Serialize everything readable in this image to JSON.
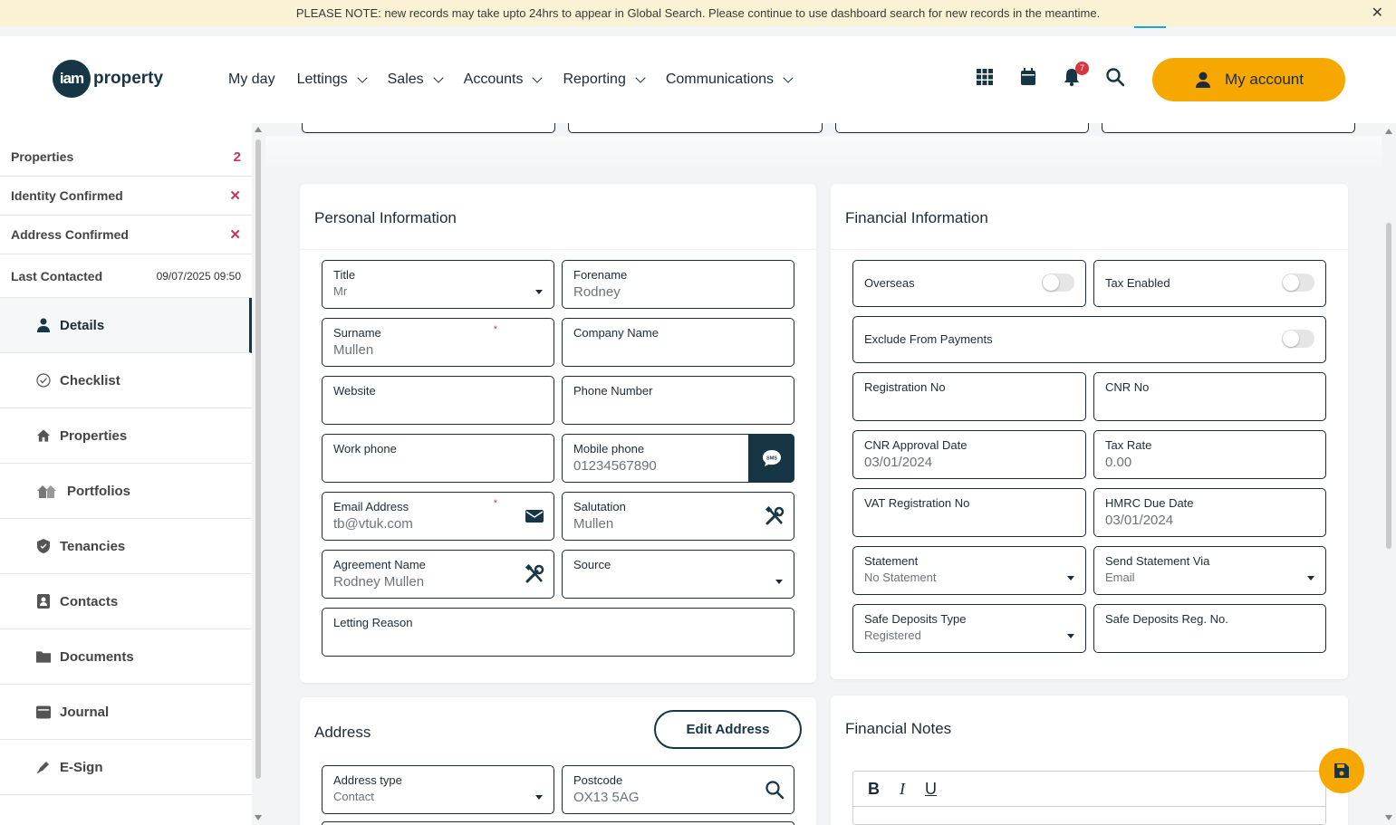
{
  "banner": {
    "text": "PLEASE NOTE: new records may take upto 24hrs to appear in Global Search. Please continue to use dashboard search for new records in the meantime.",
    "close": "✕"
  },
  "logo": {
    "disc": "iam",
    "text": "property"
  },
  "nav": [
    "My day",
    "Lettings",
    "Sales",
    "Accounts",
    "Reporting",
    "Communications"
  ],
  "header": {
    "notifications": "7",
    "account_label": "My account",
    "icons": [
      "grid-icon",
      "calendar-icon",
      "bell-icon",
      "search-icon"
    ]
  },
  "sidebar": {
    "stats": [
      {
        "label": "Properties",
        "value": "2"
      },
      {
        "label": "Identity Confirmed",
        "value": "✕"
      },
      {
        "label": "Address Confirmed",
        "value": "✕"
      },
      {
        "label": "Last Contacted",
        "value": "09/07/2025 09:50"
      }
    ],
    "items": [
      "Details",
      "Checklist",
      "Properties",
      "Portfolios",
      "Tenancies",
      "Contacts",
      "Documents",
      "Journal",
      "E-Sign"
    ]
  },
  "personal": {
    "title": "Personal Information",
    "title_field": {
      "label": "Title",
      "value": "Mr"
    },
    "forename": {
      "label": "Forename",
      "value": "Rodney"
    },
    "surname": {
      "label": "Surname",
      "value": "Mullen",
      "req": "*"
    },
    "company": {
      "label": "Company Name",
      "value": ""
    },
    "website": {
      "label": "Website",
      "value": ""
    },
    "phone": {
      "label": "Phone Number",
      "value": ""
    },
    "work": {
      "label": "Work phone",
      "value": ""
    },
    "mobile": {
      "label": "Mobile phone",
      "value": "01234567890",
      "sms": "SMS"
    },
    "email": {
      "label": "Email Address",
      "value": "tb@vtuk.com",
      "req": "*"
    },
    "salutation": {
      "label": "Salutation",
      "value": "Mullen"
    },
    "agreement": {
      "label": "Agreement Name",
      "value": "Rodney Mullen"
    },
    "source": {
      "label": "Source",
      "value": ""
    },
    "reason": {
      "label": "Letting Reason",
      "value": ""
    }
  },
  "financial": {
    "title": "Financial Information",
    "overseas": {
      "label": "Overseas",
      "on": false
    },
    "tax_enabled": {
      "label": "Tax Enabled",
      "on": false
    },
    "exclude": {
      "label": "Exclude From Payments",
      "on": false
    },
    "reg_no": {
      "label": "Registration No",
      "value": ""
    },
    "cnr_no": {
      "label": "CNR No",
      "value": ""
    },
    "cnr_date": {
      "label": "CNR Approval Date",
      "value": "03/01/2024"
    },
    "tax_rate": {
      "label": "Tax Rate",
      "value": "0.00"
    },
    "vat": {
      "label": "VAT Registration No",
      "value": ""
    },
    "hmrc": {
      "label": "HMRC Due Date",
      "value": "03/01/2024"
    },
    "statement": {
      "label": "Statement",
      "value": "No Statement"
    },
    "send_via": {
      "label": "Send Statement Via",
      "value": "Email"
    },
    "deposit_type": {
      "label": "Safe Deposits Type",
      "value": "Registered"
    },
    "deposit_reg": {
      "label": "Safe Deposits Reg. No.",
      "value": ""
    }
  },
  "address": {
    "title": "Address",
    "edit_button": "Edit Address",
    "type": {
      "label": "Address type",
      "value": "Contact"
    },
    "postcode": {
      "label": "Postcode",
      "value": "OX13 5AG"
    }
  },
  "notes": {
    "title": "Financial Notes",
    "toolbar": [
      "B",
      "I",
      "U"
    ]
  }
}
